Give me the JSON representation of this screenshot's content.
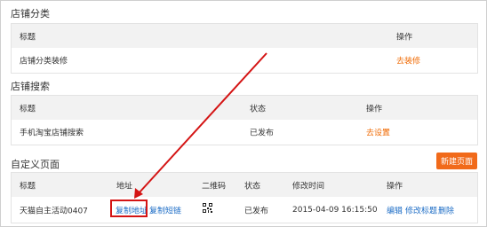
{
  "sections": {
    "category": {
      "title": "店铺分类",
      "headers": {
        "title": "标题",
        "action": "操作"
      },
      "row": {
        "title": "店铺分类装修",
        "action": "去装修"
      }
    },
    "search": {
      "title": "店铺搜索",
      "headers": {
        "title": "标题",
        "status": "状态",
        "action": "操作"
      },
      "row": {
        "title": "手机淘宝店铺搜索",
        "status": "已发布",
        "action": "去设置"
      }
    },
    "custom": {
      "title": "自定义页面",
      "new_button": "新建页面",
      "headers": {
        "title": "标题",
        "address": "地址",
        "qrcode": "二维码",
        "status": "状态",
        "modified": "修改时间",
        "action": "操作"
      },
      "row": {
        "title": "天猫自主活动0407",
        "copy_address": "复制地址",
        "copy_short": "复制短链",
        "status": "已发布",
        "modified": "2015-04-09 16:15:50",
        "edit": "编辑",
        "edit_title": "修改标题",
        "delete": "删除"
      }
    }
  },
  "colors": {
    "orange_link": "#f06b05",
    "blue_link": "#1d6dc6",
    "button_bg": "#f16a1a",
    "annotation_red": "#d41414"
  }
}
